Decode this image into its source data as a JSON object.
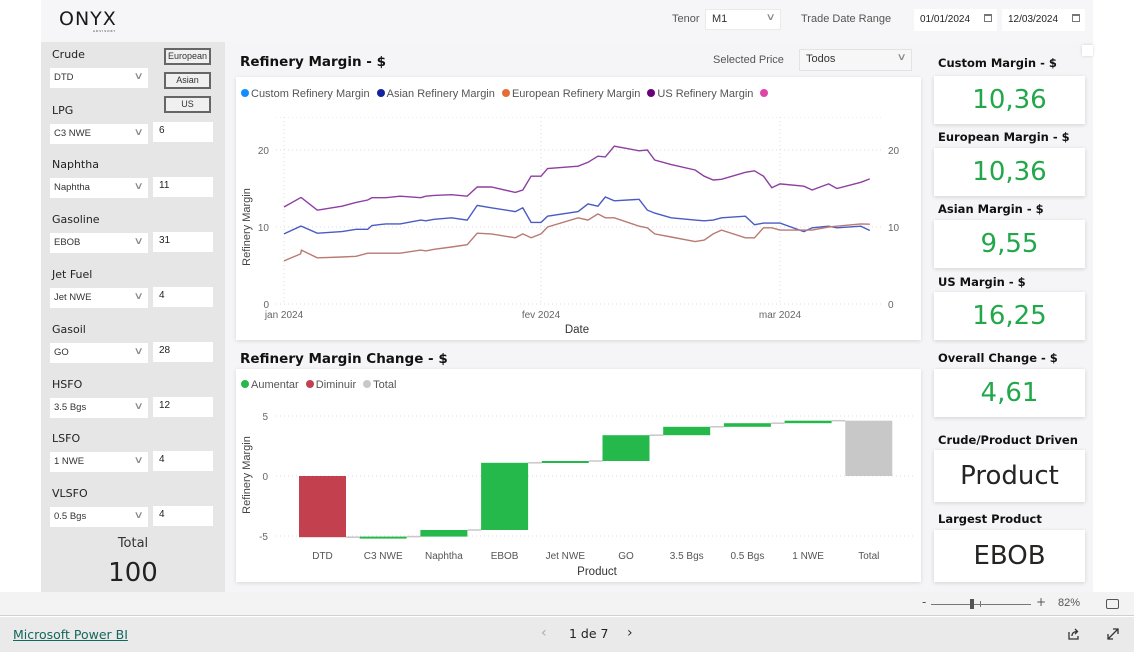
{
  "header": {
    "logo_text": "ONYX",
    "logo_subtext": "ADVISORY",
    "tenor_label": "Tenor",
    "tenor_value": "M1",
    "trade_date_label": "Trade Date Range",
    "date_from": "01/01/2024",
    "date_to": "12/03/2024"
  },
  "filters": {
    "region_buttons": [
      "European",
      "Asian",
      "US"
    ],
    "items": [
      {
        "label": "Crude",
        "selected": "DTD",
        "value": null
      },
      {
        "label": "LPG",
        "selected": "C3 NWE",
        "value": "6"
      },
      {
        "label": "Naphtha",
        "selected": "Naphtha",
        "value": "11"
      },
      {
        "label": "Gasoline",
        "selected": "EBOB",
        "value": "31"
      },
      {
        "label": "Jet Fuel",
        "selected": "Jet NWE",
        "value": "4"
      },
      {
        "label": "Gasoil",
        "selected": "GO",
        "value": "28"
      },
      {
        "label": "HSFO",
        "selected": "3.5 Bgs",
        "value": "12"
      },
      {
        "label": "LSFO",
        "selected": "1 NWE",
        "value": "4"
      },
      {
        "label": "VLSFO",
        "selected": "0.5 Bgs",
        "value": "4"
      }
    ],
    "total_label": "Total",
    "total_value": "100"
  },
  "margin_section": {
    "title": "Refinery Margin - $",
    "selected_price_label": "Selected Price",
    "selected_price_value": "Todos"
  },
  "change_section": {
    "title": "Refinery Margin Change - $"
  },
  "kpis": [
    {
      "title": "Custom Margin - $",
      "value": "10,36",
      "style": "green"
    },
    {
      "title": "European Margin - $",
      "value": "10,36",
      "style": "green"
    },
    {
      "title": "Asian Margin - $",
      "value": "9,55",
      "style": "green"
    },
    {
      "title": "US Margin - $",
      "value": "16,25",
      "style": "green"
    },
    {
      "title": "Overall Change - $",
      "value": "4,61",
      "style": "green"
    },
    {
      "title": "Crude/Product Driven",
      "value": "Product",
      "style": "dark"
    },
    {
      "title": "Largest Product",
      "value": "EBOB",
      "style": "dark"
    }
  ],
  "statusbar": {
    "zoom_minus": "-",
    "zoom_plus": "+",
    "zoom_level": "82%",
    "zoom_fraction": 0.41
  },
  "footer": {
    "link_text": "Microsoft Power BI",
    "page_indicator": "1 de 7"
  },
  "chart_data": [
    {
      "type": "line",
      "title": "Refinery Margin - $",
      "xlabel": "Date",
      "ylabel": "Refinery Margin",
      "ylim": [
        0,
        25
      ],
      "yticks": [
        0,
        10,
        20
      ],
      "xticks": [
        {
          "label": "jan 2024",
          "day": 0
        },
        {
          "label": "fev 2024",
          "day": 31
        },
        {
          "label": "mar 2024",
          "day": 60
        }
      ],
      "grid": true,
      "legend_position": "top-left",
      "legend": [
        {
          "name": "Custom Refinery Margin",
          "color": "#118dff"
        },
        {
          "name": "Asian Refinery Margin",
          "color": "#12239e"
        },
        {
          "name": "European Refinery Margin",
          "color": "#e66c37"
        },
        {
          "name": "US Refinery Margin",
          "color": "#6b007b"
        },
        {
          "name": "",
          "color": "#e044a7"
        }
      ],
      "x_days": [
        0,
        2,
        2.1,
        4,
        4.1,
        7,
        8.7,
        10.1,
        10.6,
        12.3,
        14,
        16.5,
        17.1,
        18.1,
        20.2,
        22.1,
        23.3,
        25,
        27.9,
        28.8,
        29.8,
        31,
        31.8,
        35.5,
        36.7,
        37.9,
        38.8,
        39.9,
        42.9,
        43.9,
        44.8,
        46.8,
        49.7,
        50.8,
        51.9,
        52.9,
        55.8,
        56.9,
        58,
        59,
        60,
        62.9,
        63.9,
        65.9,
        66.9,
        69.8,
        70.9
      ],
      "series": [
        {
          "name": "US Refinery Margin",
          "color": "#8e3fa1",
          "values": [
            12.6,
            13.8,
            13.8,
            12.2,
            12.2,
            12.7,
            13.2,
            13.5,
            13.8,
            13.8,
            14.0,
            13.8,
            14.0,
            14.1,
            14.2,
            14.0,
            15.2,
            15.2,
            14.5,
            14.8,
            16.6,
            16.6,
            17.6,
            17.9,
            18.4,
            19.2,
            19.1,
            20.5,
            19.9,
            20.0,
            18.7,
            18.1,
            17.4,
            16.6,
            16.1,
            16.2,
            17.1,
            17.3,
            16.6,
            15.1,
            15.6,
            15.3,
            14.8,
            15.6,
            15.0,
            15.8,
            16.25
          ]
        },
        {
          "name": "Asian Refinery Margin",
          "color": "#4a5bc4",
          "values": [
            9.1,
            10.1,
            10.1,
            9.2,
            9.2,
            9.4,
            9.7,
            9.7,
            10.2,
            10.4,
            10.4,
            10.9,
            10.8,
            11.0,
            11.2,
            10.9,
            12.8,
            12.5,
            12.0,
            12.5,
            10.6,
            10.6,
            11.4,
            12.0,
            13.0,
            12.7,
            13.9,
            13.4,
            13.6,
            12.2,
            11.8,
            11.2,
            10.9,
            10.8,
            10.9,
            11.2,
            11.4,
            10.3,
            10.5,
            10.5,
            10.5,
            9.4,
            9.9,
            10.1,
            9.9,
            10.1,
            9.55
          ]
        },
        {
          "name": "European Refinery Margin",
          "color": "#b87a72",
          "values": [
            5.6,
            6.5,
            7.0,
            6.0,
            6.0,
            6.1,
            6.2,
            6.6,
            6.6,
            6.6,
            6.6,
            7.0,
            6.9,
            7.1,
            7.4,
            7.7,
            9.2,
            9.1,
            8.6,
            9.1,
            8.6,
            9.1,
            10.0,
            11.2,
            10.9,
            11.7,
            11.2,
            11.2,
            10.1,
            9.9,
            9.1,
            8.7,
            8.1,
            8.3,
            9.1,
            9.6,
            8.6,
            8.6,
            9.9,
            9.9,
            9.6,
            9.6,
            9.6,
            10.0,
            10.1,
            10.4,
            10.36
          ]
        }
      ]
    },
    {
      "type": "bar",
      "subtype": "waterfall",
      "title": "Refinery Margin Change - $",
      "xlabel": "Product",
      "ylabel": "Refinery Margin",
      "ylim": [
        -6,
        7
      ],
      "yticks": [
        -5,
        0,
        5
      ],
      "grid": true,
      "legend_position": "top-left",
      "legend": [
        {
          "name": "Aumentar",
          "color": "#25b84b"
        },
        {
          "name": "Diminuir",
          "color": "#c3404e"
        },
        {
          "name": "Total",
          "color": "#c8c8c8"
        }
      ],
      "categories": [
        "DTD",
        "C3 NWE",
        "Naphtha",
        "EBOB",
        "Jet NWE",
        "GO",
        "3.5 Bgs",
        "0.5 Bgs",
        "1 NWE",
        "Total"
      ],
      "values": [
        -5.1,
        0.05,
        0.55,
        5.6,
        0.15,
        2.15,
        0.7,
        0.3,
        0.21,
        4.61
      ]
    }
  ]
}
